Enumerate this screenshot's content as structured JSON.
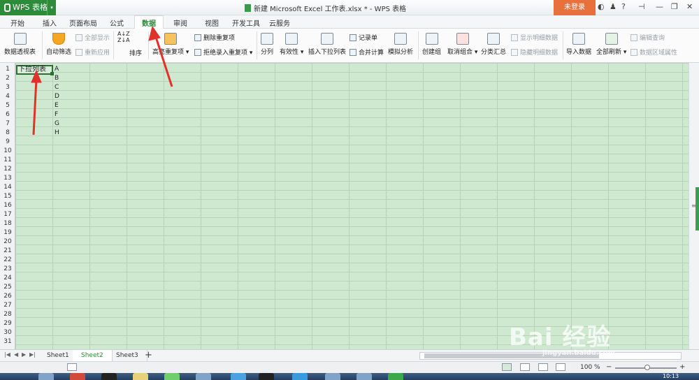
{
  "app": {
    "name": "WPS 表格",
    "title": "新建 Microsoft Excel 工作表.xlsx * - WPS 表格",
    "login": "未登录"
  },
  "titlebar_icons": [
    "help-icon",
    "shirt-icon",
    "question-icon",
    "pin-icon",
    "minimize-icon",
    "restore-icon",
    "close-icon"
  ],
  "menu": {
    "tabs": [
      "开始",
      "插入",
      "页面布局",
      "公式",
      "数据",
      "审阅",
      "视图",
      "开发工具",
      "云服务"
    ],
    "active": "数据"
  },
  "ribbon": {
    "pivot": "数据透视表",
    "autofilter": "自动筛选",
    "show_all": "全部显示",
    "reapply": "重新应用",
    "sort": "排序",
    "highlight_dup": "高亮重复项",
    "remove_dup": "删除重复项",
    "reject_dup": "拒绝录入重复项",
    "split": "分列",
    "validity": "有效性",
    "insert_dropdown": "插入下拉列表",
    "record": "记录单",
    "merge_calc": "合并计算",
    "simulate": "模拟分析",
    "create_group": "创建组",
    "ungroup": "取消组合",
    "subtotal": "分类汇总",
    "show_detail": "显示明细数据",
    "hide_detail": "隐藏明细数据",
    "import": "导入数据",
    "refresh_all": "全部刷新",
    "edit_query": "编辑查询",
    "data_props": "数据区域属性"
  },
  "sheet": {
    "rows": [
      "1",
      "2",
      "3",
      "4",
      "5",
      "6",
      "7",
      "8",
      "9",
      "10",
      "11",
      "12",
      "13",
      "14",
      "15",
      "16",
      "17",
      "18",
      "19",
      "20",
      "21",
      "22",
      "23",
      "24",
      "25",
      "26",
      "27",
      "28",
      "29",
      "30",
      "31"
    ],
    "a1": "下拉列表",
    "col_b": [
      "A",
      "B",
      "C",
      "D",
      "E",
      "F",
      "G",
      "H"
    ]
  },
  "tabs": {
    "sheets": [
      "Sheet1",
      "Sheet2",
      "Sheet3"
    ],
    "active": "Sheet2",
    "add": "+"
  },
  "status": {
    "zoom": "100 %",
    "minus": "−",
    "plus": "+"
  },
  "taskbar": {
    "clock": "10:13"
  },
  "watermark": {
    "main": "Bai 经验",
    "sub": "jingyan.baidu.com"
  },
  "colors": {
    "accent": "#2e8b3a",
    "grid_bg": "#cfe8d0",
    "login": "#e8703a",
    "arrow": "#e0322a"
  }
}
